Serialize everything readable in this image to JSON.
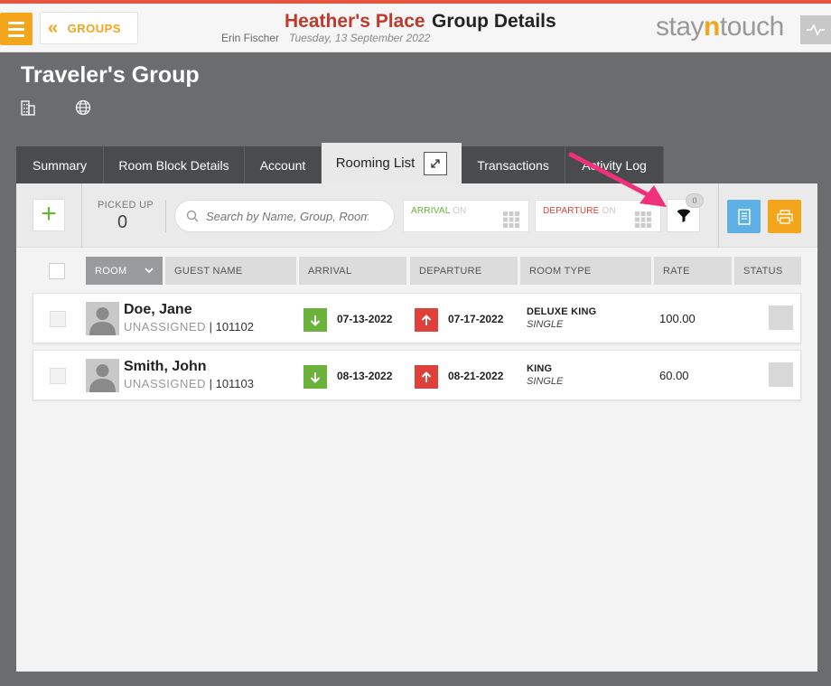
{
  "header": {
    "groups_label": "GROUPS",
    "hotel_name": "Heather's Place",
    "page_title": "Group Details",
    "user_name": "Erin Fischer",
    "date": "Tuesday, 13 September 2022",
    "logo_stay": "stay",
    "logo_n": "n",
    "logo_touch": "touch"
  },
  "group": {
    "title": "Traveler's Group"
  },
  "tabs": [
    {
      "label": "Summary"
    },
    {
      "label": "Room Block Details"
    },
    {
      "label": "Account"
    },
    {
      "label": "Rooming List",
      "active": true
    },
    {
      "label": "Transactions"
    },
    {
      "label": "Activity Log"
    }
  ],
  "toolbar": {
    "picked_up_label": "PICKED UP",
    "picked_up_value": "0",
    "search_placeholder": "Search by Name, Group, Room",
    "arrival_label": "ARRIVAL",
    "arrival_on": "ON",
    "departure_label": "DEPARTURE",
    "departure_on": "ON",
    "filter_count": "0"
  },
  "columns": {
    "room": "ROOM",
    "guest_name": "GUEST NAME",
    "arrival": "ARRIVAL",
    "departure": "DEPARTURE",
    "room_type": "ROOM TYPE",
    "rate": "RATE",
    "status": "STATUS"
  },
  "rows": [
    {
      "guest": "Doe, Jane",
      "room_status": "UNASSIGNED",
      "confirmation": "| 101102",
      "arrival": "07-13-2022",
      "departure": "07-17-2022",
      "room_type": "DELUXE KING",
      "occupancy": "SINGLE",
      "rate": "100.00"
    },
    {
      "guest": "Smith, John",
      "room_status": "UNASSIGNED",
      "confirmation": "| 101103",
      "arrival": "08-13-2022",
      "departure": "08-21-2022",
      "room_type": "KING",
      "occupancy": "SINGLE",
      "rate": "60.00"
    }
  ],
  "colors": {
    "accent_orange": "#f3a51c",
    "hotel_red": "#c0392b",
    "arrival_green": "#6bb23a",
    "departure_red": "#e0403a",
    "print_blue": "#5fb0e5",
    "annotation_pink": "#f0307a"
  }
}
